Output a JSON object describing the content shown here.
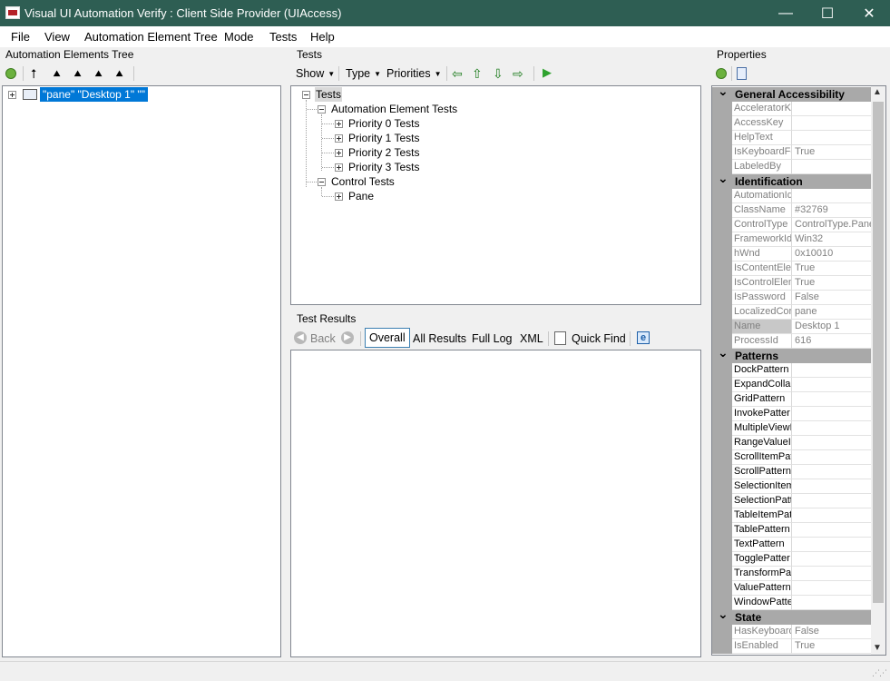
{
  "window": {
    "title": "Visual UI Automation Verify : Client Side Provider (UIAccess)",
    "minimize": "—",
    "maximize": "☐",
    "close": "✕"
  },
  "menu": [
    "File",
    "View",
    "Automation Element Tree",
    "Mode",
    "Tests",
    "Help"
  ],
  "left_pane": {
    "label": "Automation Elements Tree",
    "root_node": "\"pane\" \"Desktop 1\" \"\""
  },
  "tests_pane": {
    "label": "Tests",
    "toolbar": {
      "show": "Show",
      "type": "Type",
      "priorities": "Priorities"
    },
    "tree": {
      "root": "Tests",
      "automation_element_tests": "Automation Element Tests",
      "priorities": [
        "Priority 0 Tests",
        "Priority 1 Tests",
        "Priority 2 Tests",
        "Priority 3 Tests"
      ],
      "control_tests": "Control Tests",
      "pane": "Pane"
    }
  },
  "results_pane": {
    "label": "Test Results",
    "toolbar": {
      "back": "Back",
      "overall": "Overall",
      "all_results": "All Results",
      "full_log": "Full Log",
      "xml": "XML",
      "quick_find": "Quick Find"
    }
  },
  "properties": {
    "label": "Properties",
    "categories": [
      {
        "name": "General Accessibility",
        "rows": [
          {
            "name": "AcceleratorK",
            "value": ""
          },
          {
            "name": "AccessKey",
            "value": ""
          },
          {
            "name": "HelpText",
            "value": ""
          },
          {
            "name": "IsKeyboardFo",
            "value": "True"
          },
          {
            "name": "LabeledBy",
            "value": ""
          }
        ]
      },
      {
        "name": "Identification",
        "rows": [
          {
            "name": "AutomationId",
            "value": ""
          },
          {
            "name": "ClassName",
            "value": "#32769"
          },
          {
            "name": "ControlType",
            "value": "ControlType.Pane"
          },
          {
            "name": "FrameworkId",
            "value": "Win32"
          },
          {
            "name": "hWnd",
            "value": "0x10010"
          },
          {
            "name": "IsContentEle",
            "value": "True"
          },
          {
            "name": "IsControlElem",
            "value": "True"
          },
          {
            "name": "IsPassword",
            "value": "False"
          },
          {
            "name": "LocalizedCor",
            "value": "pane"
          },
          {
            "name": "Name",
            "value": "Desktop 1"
          },
          {
            "name": "ProcessId",
            "value": "616"
          }
        ]
      },
      {
        "name": "Patterns",
        "rows": [
          {
            "name": "DockPattern",
            "value": ""
          },
          {
            "name": "ExpandCollap",
            "value": ""
          },
          {
            "name": "GridPattern",
            "value": ""
          },
          {
            "name": "InvokePatter",
            "value": ""
          },
          {
            "name": "MultipleViewI",
            "value": ""
          },
          {
            "name": "RangeValueI",
            "value": ""
          },
          {
            "name": "ScrollItemPat",
            "value": ""
          },
          {
            "name": "ScrollPattern",
            "value": ""
          },
          {
            "name": "SelectionItem",
            "value": ""
          },
          {
            "name": "SelectionPatt",
            "value": ""
          },
          {
            "name": "TableItemPat",
            "value": ""
          },
          {
            "name": "TablePattern",
            "value": ""
          },
          {
            "name": "TextPattern",
            "value": ""
          },
          {
            "name": "TogglePatter",
            "value": ""
          },
          {
            "name": "TransformPat",
            "value": ""
          },
          {
            "name": "ValuePattern",
            "value": ""
          },
          {
            "name": "WindowPatte",
            "value": ""
          }
        ]
      },
      {
        "name": "State",
        "rows": [
          {
            "name": "HasKeyboard",
            "value": "False"
          },
          {
            "name": "IsEnabled",
            "value": "True"
          }
        ]
      }
    ]
  },
  "colors": {
    "titlebar": "#2e5e53",
    "selection": "#0078d7",
    "category": "#a9a9a9"
  }
}
